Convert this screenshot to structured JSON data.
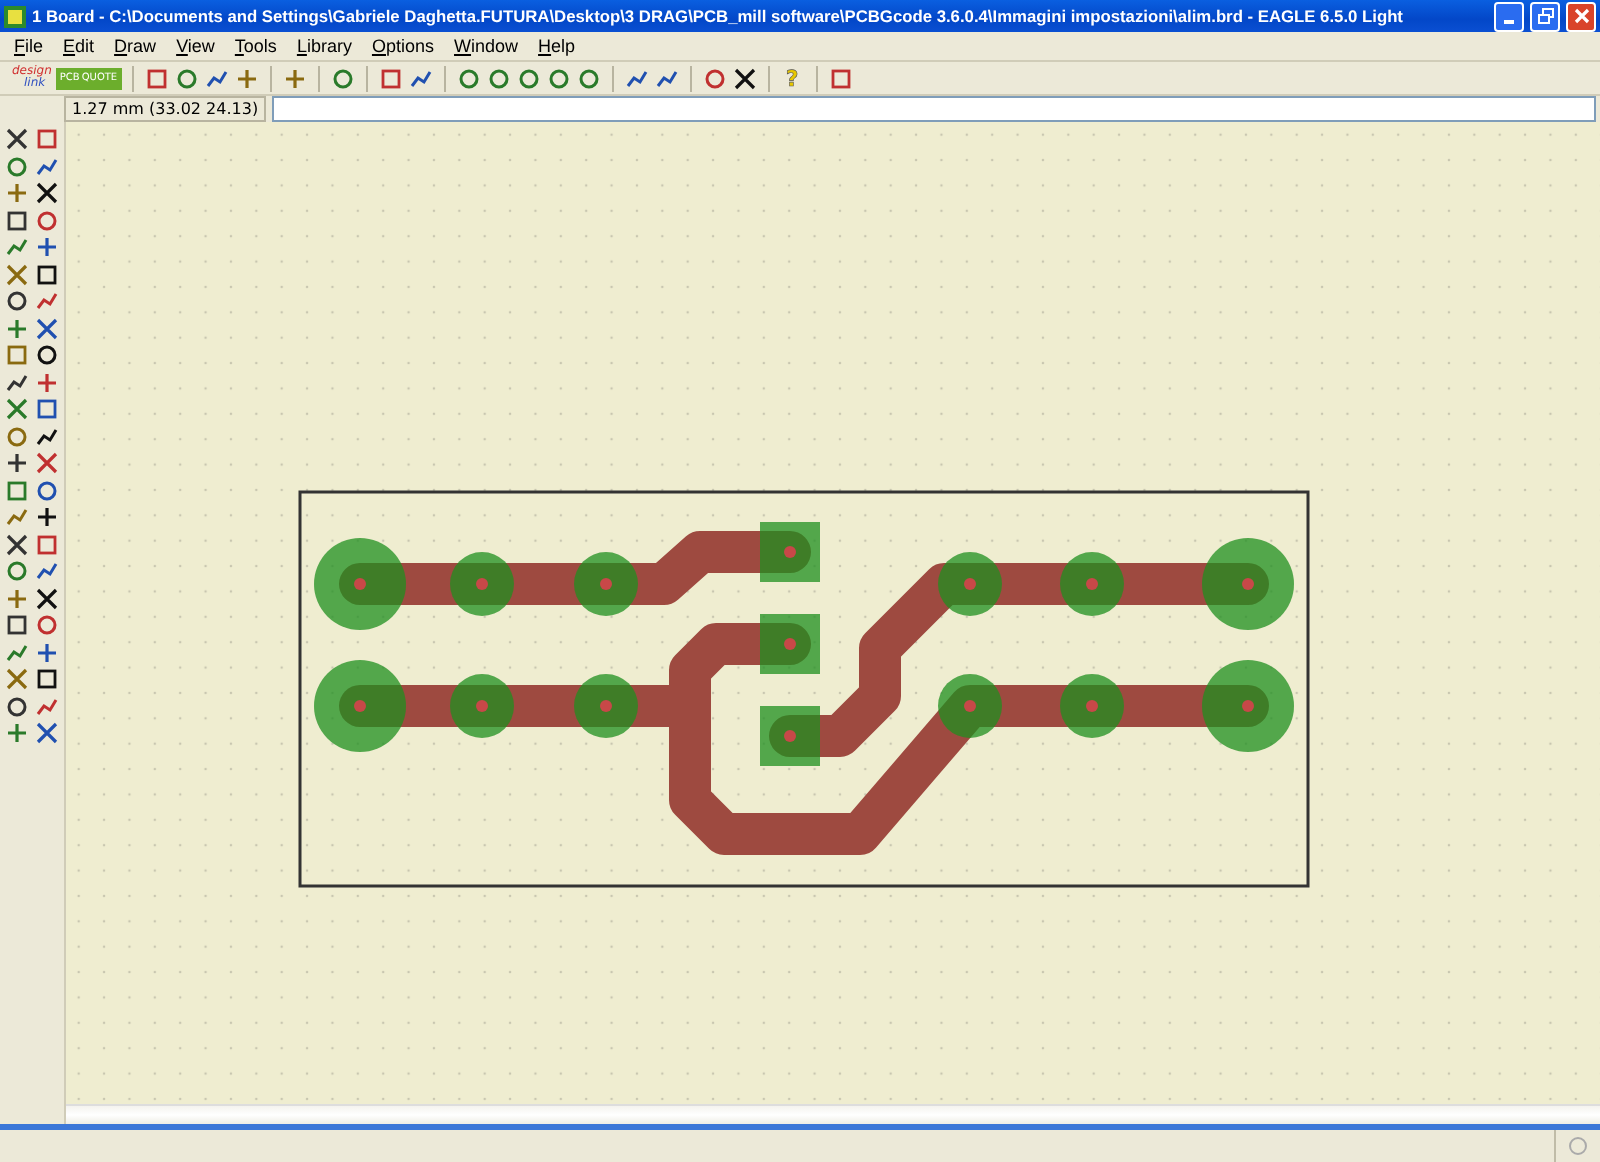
{
  "window": {
    "title": "1 Board - C:\\Documents and Settings\\Gabriele Daghetta.FUTURA\\Desktop\\3 DRAG\\PCB_mill software\\PCBGcode 3.6.0.4\\Immagini impostazioni\\alim.brd - EAGLE 6.5.0 Light"
  },
  "menu": [
    "File",
    "Edit",
    "Draw",
    "View",
    "Tools",
    "Library",
    "Options",
    "Window",
    "Help"
  ],
  "toolbar": {
    "design_link_logo": {
      "line_1": "design",
      "line_2": "link"
    },
    "pcb_quote_logo": {
      "line_1": "PCB",
      "line_2": "QUOTE"
    },
    "help_button": "?"
  },
  "command_bar": {
    "coordinates": "1.27 mm (33.02 24.13)"
  }
}
